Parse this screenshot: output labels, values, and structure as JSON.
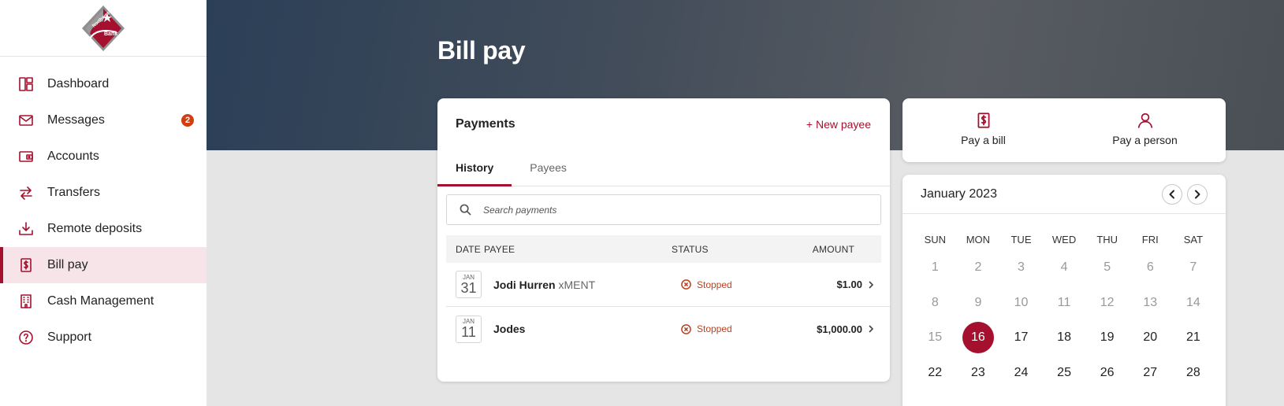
{
  "sidebar": {
    "logo": {
      "word1": "Northwest",
      "word2": "Bank",
      "colors": {
        "red": "#a5102f",
        "gray": "#8a8a8a"
      }
    },
    "items": [
      {
        "label": "Dashboard",
        "icon": "dashboard-icon"
      },
      {
        "label": "Messages",
        "icon": "envelope-icon",
        "badge": "2"
      },
      {
        "label": "Accounts",
        "icon": "wallet-icon"
      },
      {
        "label": "Transfers",
        "icon": "arrows-transfer-icon"
      },
      {
        "label": "Remote deposits",
        "icon": "download-tray-icon"
      },
      {
        "label": "Bill pay",
        "icon": "receipt-dollar-icon",
        "active": true
      },
      {
        "label": "Cash Management",
        "icon": "building-icon"
      },
      {
        "label": "Support",
        "icon": "question-circle-icon"
      }
    ]
  },
  "page": {
    "title": "Bill pay"
  },
  "payments": {
    "title": "Payments",
    "new_payee": "+ New payee",
    "tabs": [
      {
        "label": "History",
        "active": true
      },
      {
        "label": "Payees",
        "active": false
      }
    ],
    "search_placeholder": "Search payments",
    "columns": {
      "date": "DATE",
      "payee": "PAYEE",
      "status": "STATUS",
      "amount": "AMOUNT"
    },
    "rows": [
      {
        "month": "JAN",
        "day": "31",
        "payee": "Jodi Hurren",
        "nickname": "xMENT",
        "status": "Stopped",
        "amount": "$1.00"
      },
      {
        "month": "JAN",
        "day": "11",
        "payee": "Jodes",
        "nickname": "",
        "status": "Stopped",
        "amount": "$1,000.00"
      }
    ]
  },
  "quick_actions": {
    "pay_bill": "Pay a bill",
    "pay_person": "Pay a person"
  },
  "calendar": {
    "title": "January 2023",
    "weekdays": [
      "SUN",
      "MON",
      "TUE",
      "WED",
      "THU",
      "FRI",
      "SAT"
    ],
    "days": [
      1,
      2,
      3,
      4,
      5,
      6,
      7,
      8,
      9,
      10,
      11,
      12,
      13,
      14,
      15,
      16,
      17,
      18,
      19,
      20,
      21,
      22,
      23,
      24,
      25,
      26,
      27,
      28
    ],
    "today": 16,
    "accent": "#a5102f"
  },
  "colors": {
    "accent": "#a5102f",
    "status_stopped": "#c0401e",
    "badge": "#cf3f12"
  }
}
